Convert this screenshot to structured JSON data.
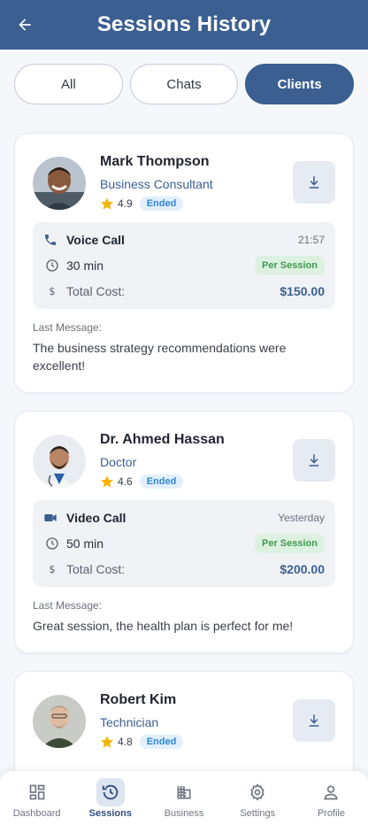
{
  "header": {
    "title": "Sessions History",
    "back_icon": "arrow-left-icon"
  },
  "filters": [
    {
      "label": "All",
      "active": false
    },
    {
      "label": "Chats",
      "active": false
    },
    {
      "label": "Clients",
      "active": true
    }
  ],
  "sessions": [
    {
      "name": "Mark Thompson",
      "role": "Business Consultant",
      "rating": "4.9",
      "status": "Ended",
      "call_type": "Voice Call",
      "call_icon": "phone-icon",
      "time": "21:57",
      "duration": "30 min",
      "plan": "Per Session",
      "cost_label": "Total Cost:",
      "cost": "$150.00",
      "last_message_label": "Last Message:",
      "last_message": "The business strategy recommendations were excellent!"
    },
    {
      "name": "Dr. Ahmed Hassan",
      "role": "Doctor",
      "rating": "4.6",
      "status": "Ended",
      "call_type": "Video Call",
      "call_icon": "video-camera-icon",
      "time": "Yesterday",
      "duration": "50 min",
      "plan": "Per Session",
      "cost_label": "Total Cost:",
      "cost": "$200.00",
      "last_message_label": "Last Message:",
      "last_message": "Great session, the health plan is perfect for me!"
    },
    {
      "name": "Robert Kim",
      "role": "Technician",
      "rating": "4.8",
      "status": "Ended"
    }
  ],
  "nav": [
    {
      "label": "Dashboard",
      "icon": "dashboard-icon",
      "active": false
    },
    {
      "label": "Sessions",
      "icon": "history-icon",
      "active": true
    },
    {
      "label": "Business",
      "icon": "building-icon",
      "active": false
    },
    {
      "label": "Settings",
      "icon": "gear-icon",
      "active": false
    },
    {
      "label": "Profile",
      "icon": "person-icon",
      "active": false
    }
  ],
  "colors": {
    "primary": "#3b5f91",
    "accent_green": "#3f9a4e",
    "badge_blue": "#2d86d6",
    "star": "#f5b400"
  }
}
